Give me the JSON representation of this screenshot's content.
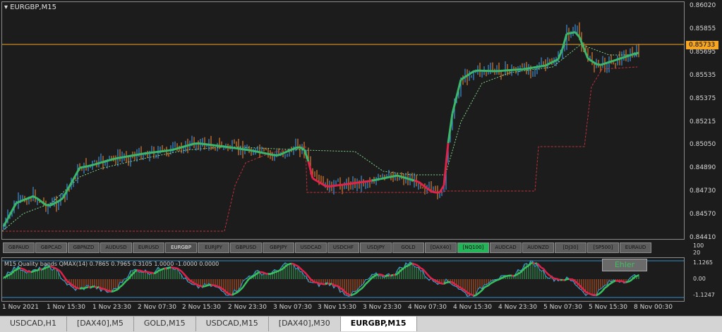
{
  "chart": {
    "title": "EURGBP,M15",
    "current_price": "0.85733",
    "price_labels": [
      "0.86020",
      "0.85855",
      "0.85695",
      "0.85535",
      "0.85375",
      "0.85215",
      "0.85050",
      "0.84890",
      "0.84730",
      "0.84570",
      "0.84410"
    ],
    "indicator_title": "M15 Quality bands QMAX(14) 0.7865 0.7965 0.3105 1.0000 -1.0000 0.0000",
    "indicator_scale": [
      "100",
      "1.1265",
      "0.00",
      "-1.1247",
      "20"
    ],
    "ehler_label": "Ehler",
    "time_labels": [
      "1 Nov 2021",
      "1 Nov 15:30",
      "1 Nov 23:30",
      "2 Nov 07:30",
      "2 Nov 15:30",
      "2 Nov 23:30",
      "3 Nov 07:30",
      "3 Nov 15:30",
      "3 Nov 23:30",
      "4 Nov 07:30",
      "4 Nov 15:30",
      "4 Nov 23:30",
      "5 Nov 07:30",
      "5 Nov 15:30",
      "8 Nov 00:30"
    ],
    "colors": {
      "bull": "#3f8fd8",
      "bear": "#e07b2a",
      "ma_up": "#3ab76a",
      "ma_down": "#e0234a",
      "price_line": "#f5a623",
      "stop": "#c0303a",
      "signal": "#7fd48a"
    }
  },
  "symbol_buttons": [
    "GBPAUD",
    "GBPCAD",
    "GBPNZD",
    "AUDUSD",
    "EURUSD",
    "EURGBP",
    "EURJPY",
    "GBPUSD",
    "GBPJPY",
    "USDCAD",
    "USDCHF",
    "USDJPY",
    "GOLD",
    "[DAX40]",
    "[NQ100]",
    "AUDCAD",
    "AUDNZD",
    "[DJ30]",
    "[SP500]",
    "EURAUD"
  ],
  "selected_symbol": "EURGBP",
  "highlight_symbol": "[NQ100]",
  "tabs": [
    "USDCAD,H1",
    "[DAX40],M5",
    "GOLD,M15",
    "USDCAD,M15",
    "[DAX40],M30",
    "EURGBP,M15"
  ],
  "active_tab": "EURGBP,M15"
}
